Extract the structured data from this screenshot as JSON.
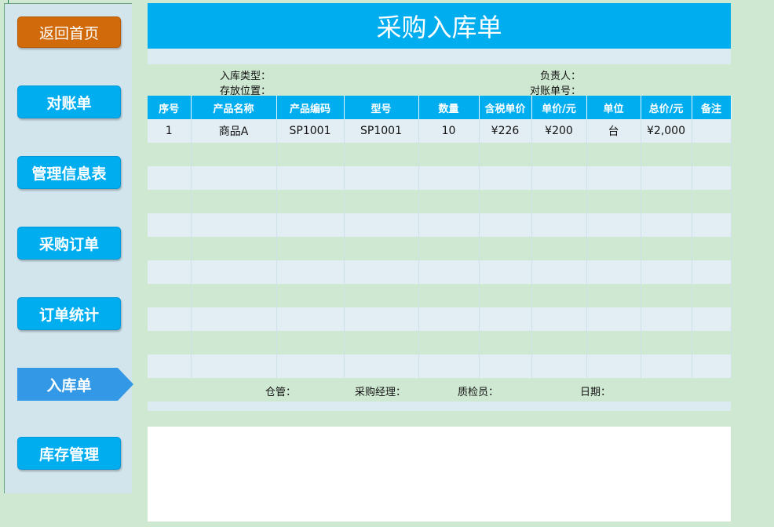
{
  "nav": {
    "home": "返回首页",
    "items": [
      "对账单",
      "管理信息表",
      "采购订单",
      "订单统计",
      "入库单",
      "库存管理"
    ],
    "active_index": 4
  },
  "form": {
    "title": "采购入库单",
    "labels": {
      "type": "入库类型：",
      "location": "存放位置：",
      "owner": "负责人：",
      "statement_no": "对账单号："
    }
  },
  "table": {
    "headers": [
      "序号",
      "产品名称",
      "产品编码",
      "型号",
      "数量",
      "含税单价",
      "单价/元",
      "单位",
      "总价/元",
      "备注"
    ],
    "rows": [
      [
        "1",
        "商品A",
        "SP1001",
        "SP1001",
        "10",
        "¥226",
        "¥200",
        "台",
        "¥2,000",
        ""
      ]
    ],
    "empty_rows": 10
  },
  "footer": {
    "keeper": "仓管：",
    "manager": "采购经理：",
    "inspector": "质检员：",
    "date": "日期："
  },
  "colors": {
    "accent": "#00aef0",
    "home_button": "#d06a0a",
    "active_tab": "#3399e6",
    "row_light": "#e2eef4",
    "row_green": "#cfe8d2"
  }
}
